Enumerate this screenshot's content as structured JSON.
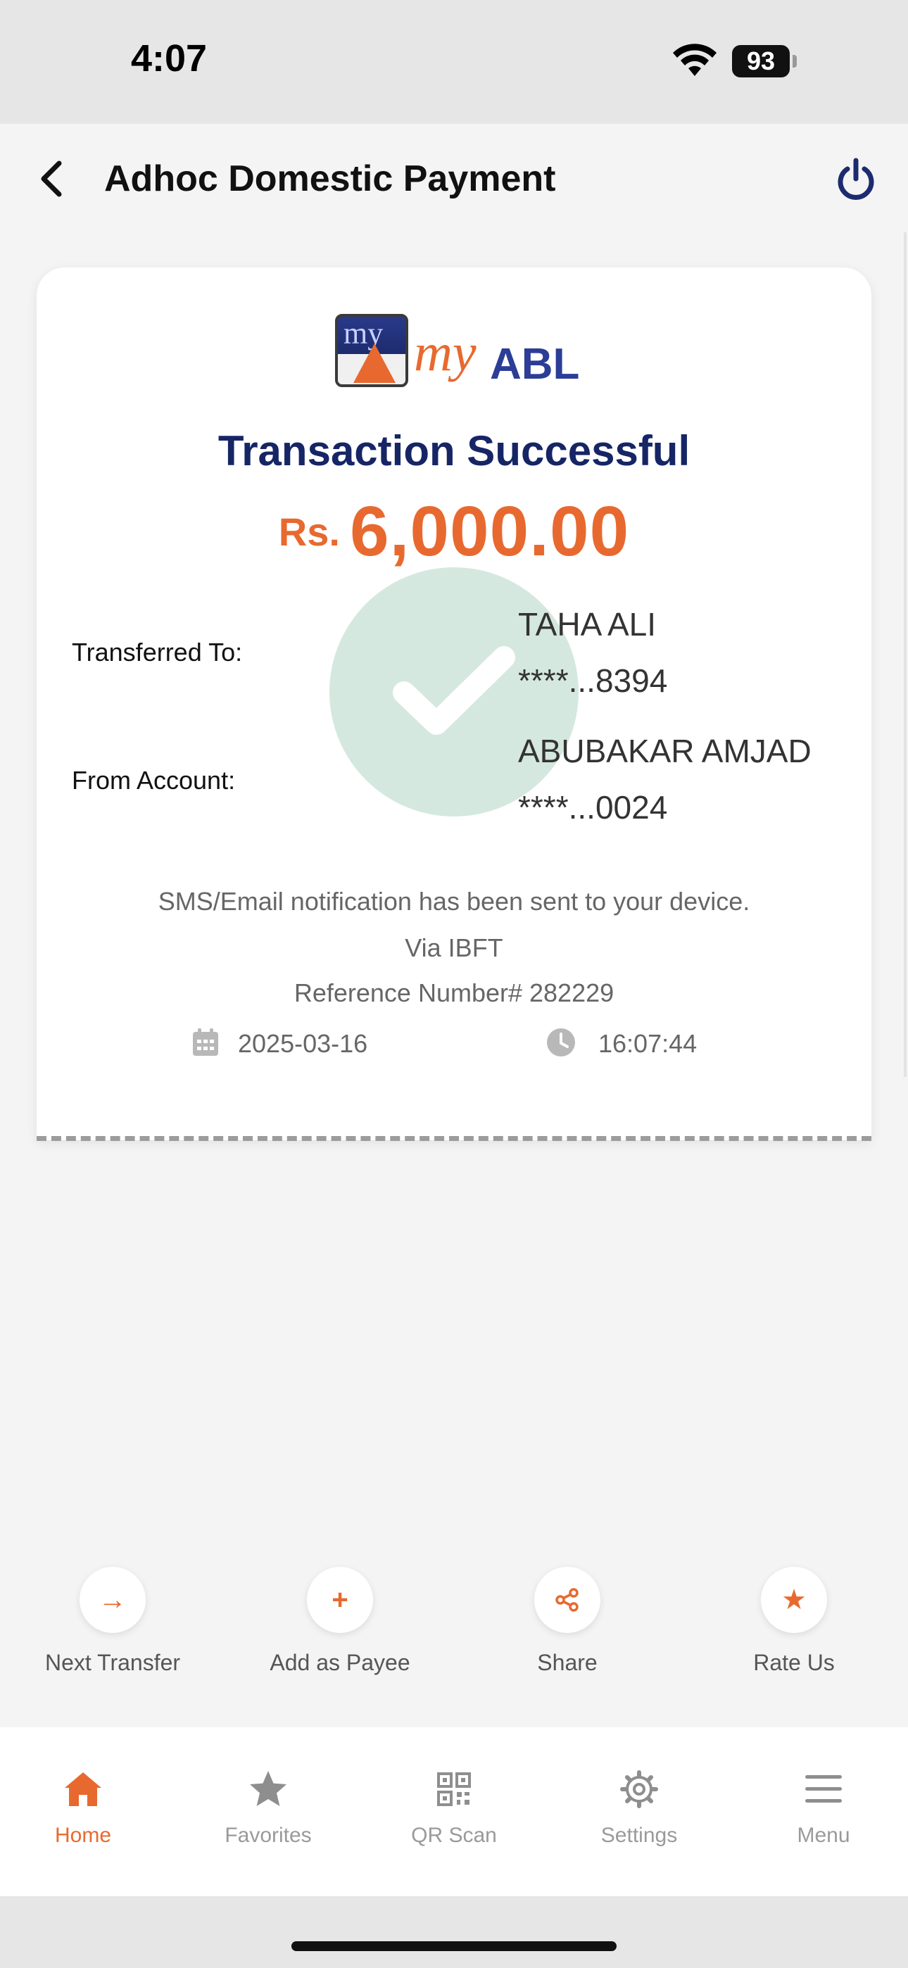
{
  "status_bar": {
    "time": "4:07",
    "battery": "93"
  },
  "header": {
    "title": "Adhoc Domestic Payment"
  },
  "receipt": {
    "logo_text": {
      "box": "my",
      "brand_prefix": "my",
      "brand_suffix": "ABL"
    },
    "title": "Transaction Successful",
    "currency": "Rs.",
    "amount": "6,000.00",
    "transferred_to_label": "Transferred To:",
    "to_name": "TAHA ALI",
    "to_account": "****...8394",
    "from_account_label": "From Account:",
    "from_name": "ABUBAKAR AMJAD",
    "from_account": "****...0024",
    "notification": "SMS/Email notification has been sent to your device.",
    "via": "Via IBFT",
    "reference": "Reference Number# 282229",
    "date": "2025-03-16",
    "time": "16:07:44"
  },
  "actions": [
    {
      "label": "Next Transfer",
      "icon": "arrow-right-icon",
      "glyph": "→"
    },
    {
      "label": "Add as Payee",
      "icon": "plus-icon",
      "glyph": "+"
    },
    {
      "label": "Share",
      "icon": "share-icon",
      "glyph": ""
    },
    {
      "label": "Rate Us",
      "icon": "star-icon",
      "glyph": "★"
    }
  ],
  "bottom_nav": [
    {
      "label": "Home",
      "icon": "home-icon",
      "active": true
    },
    {
      "label": "Favorites",
      "icon": "star-icon",
      "active": false
    },
    {
      "label": "QR Scan",
      "icon": "qr-icon",
      "active": false
    },
    {
      "label": "Settings",
      "icon": "gear-icon",
      "active": false
    },
    {
      "label": "Menu",
      "icon": "menu-icon",
      "active": false
    }
  ],
  "colors": {
    "accent": "#e8692f",
    "navy": "#162565",
    "success_circle": "#d5e8df"
  }
}
